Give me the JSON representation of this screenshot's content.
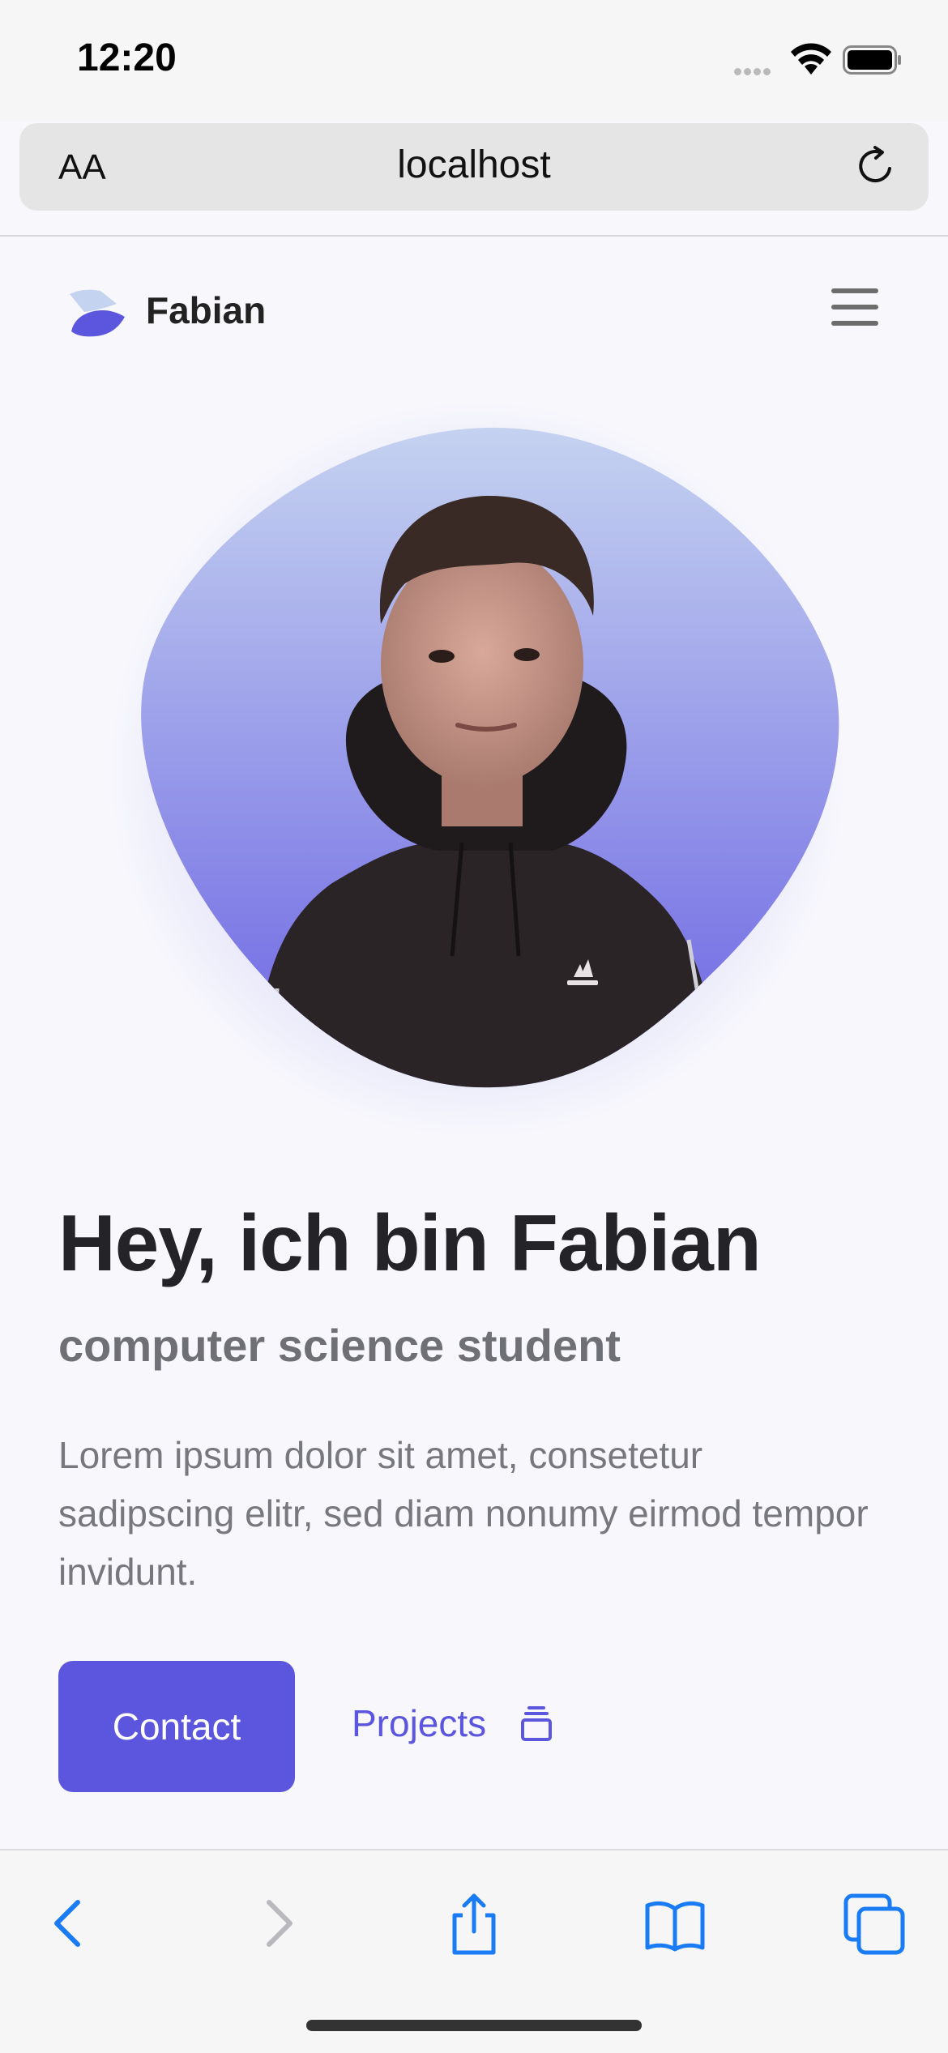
{
  "status_bar": {
    "time": "12:20"
  },
  "browser": {
    "text_size_label": "AA",
    "url": "localhost"
  },
  "nav": {
    "brand": "Fabian"
  },
  "hero": {
    "headline": "Hey, ich bin Fabian",
    "subtitle": "computer science student",
    "description": "Lorem ipsum dolor sit amet, consetetur sadipscing elitr, sed diam nonumy eirmod tempor invidunt.",
    "contact_label": "Contact",
    "projects_label": "Projects"
  },
  "colors": {
    "accent": "#5b56dd",
    "blob_top": "#c5d2f0",
    "blob_bottom": "#6b63e3",
    "browser_blue": "#1a7cf5"
  },
  "icons": {
    "logo": "layered-shapes-logo",
    "menu": "hamburger-icon",
    "projects": "stack-icon",
    "toolbar": [
      "back-icon",
      "forward-icon",
      "share-icon",
      "bookmarks-icon",
      "tabs-icon"
    ]
  }
}
